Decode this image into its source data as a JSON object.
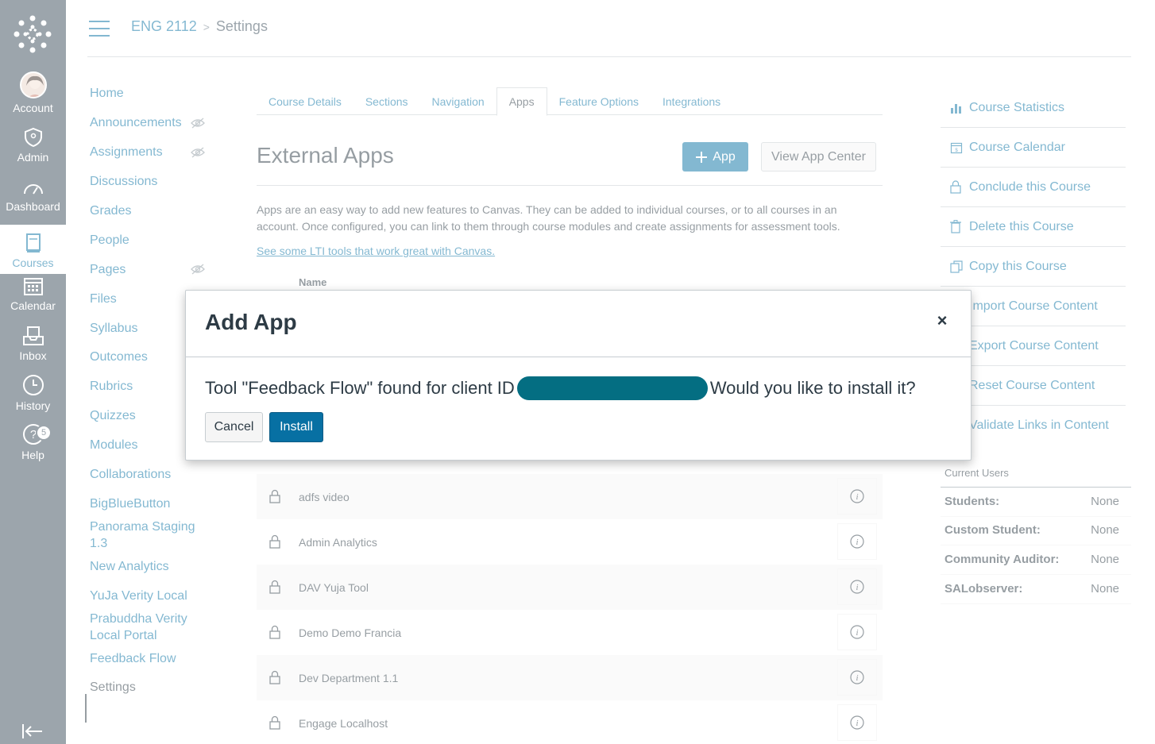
{
  "global_nav": {
    "account": "Account",
    "admin": "Admin",
    "dashboard": "Dashboard",
    "courses": "Courses",
    "calendar": "Calendar",
    "inbox": "Inbox",
    "history": "History",
    "help": "Help",
    "help_badge": "5"
  },
  "header": {
    "course": "ENG 2112",
    "separator": ">",
    "current": "Settings"
  },
  "course_nav": [
    "Home",
    "Announcements",
    "Assignments",
    "Discussions",
    "Grades",
    "People",
    "Pages",
    "Files",
    "Syllabus",
    "Outcomes",
    "Rubrics",
    "Quizzes",
    "Modules",
    "Collaborations",
    "BigBlueButton",
    "Panorama Staging 1.3",
    "New Analytics",
    "YuJa Verity Local",
    "Prabuddha Verity Local Portal",
    "Feedback Flow",
    "Settings"
  ],
  "tabs": [
    "Course Details",
    "Sections",
    "Navigation",
    "Apps",
    "Feature Options",
    "Integrations"
  ],
  "main": {
    "title": "External Apps",
    "add_app": "App",
    "view_center": "View App Center",
    "description": "Apps are an easy way to add new features to Canvas. They can be added to individual courses, or to all courses in an account. Once configured, you can link to them through course modules and create assignments for assessment tools.",
    "lti_link": "See some LTI tools that work great with Canvas.",
    "col_name": "Name",
    "apps": [
      "adfs video",
      "Admin Analytics",
      "DAV Yuja Tool",
      "Demo Demo Francia",
      "Dev Department 1.1",
      "Engage Localhost"
    ]
  },
  "sidebar": {
    "links": [
      "Course Statistics",
      "Course Calendar",
      "Conclude this Course",
      "Delete this Course",
      "Copy this Course",
      "Import Course Content",
      "Export Course Content",
      "Reset Course Content",
      "Validate Links in Content"
    ],
    "current_users_title": "Current Users",
    "users": [
      {
        "role": "Students:",
        "value": "None"
      },
      {
        "role": "Custom Student:",
        "value": "None"
      },
      {
        "role": "Community Auditor:",
        "value": "None"
      },
      {
        "role": "SALobserver:",
        "value": "None"
      }
    ]
  },
  "dialog": {
    "title": "Add App",
    "close": "×",
    "message_before": "Tool \"Feedback Flow\" found for client ID",
    "message_after": "Would you like to install it?",
    "cancel": "Cancel",
    "install": "Install"
  },
  "colors": {
    "nav_bg": "#394B58",
    "link": "#0770A3",
    "redaction": "#046E82"
  }
}
